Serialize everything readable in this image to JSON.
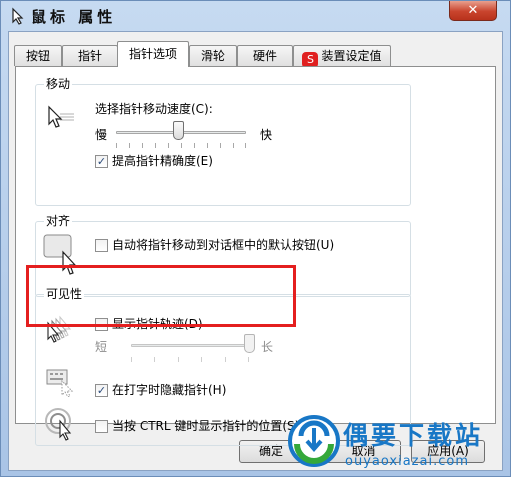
{
  "window": {
    "title": "鼠标 属性",
    "close_glyph": "✕"
  },
  "tabs": [
    {
      "label": "按钮"
    },
    {
      "label": "指针"
    },
    {
      "label": "指针选项",
      "active": true
    },
    {
      "label": "滑轮"
    },
    {
      "label": "硬件"
    },
    {
      "label": "装置设定值",
      "icon": "synaptics-icon"
    }
  ],
  "motion": {
    "title": "移动",
    "speed_label": "选择指针移动速度(C):",
    "slow": "慢",
    "fast": "快",
    "speed_level": 0.48,
    "precision_label": "提高指针精确度(E)",
    "precision_checked": true
  },
  "snap": {
    "title": "对齐",
    "label": "自动将指针移动到对话框中的默认按钮(U)",
    "checked": false
  },
  "visibility": {
    "title": "可见性",
    "trails_label": "显示指针轨迹(D)",
    "trails_checked": false,
    "short": "短",
    "long": "长",
    "trail_level": 1.0,
    "hide_label": "在打字时隐藏指针(H)",
    "hide_checked": true,
    "ctrl_label": "当按 CTRL 键时显示指针的位置(S)",
    "ctrl_checked": false
  },
  "buttons": {
    "ok": "确定",
    "cancel": "取消",
    "apply": "应用(A)"
  },
  "watermark": {
    "title": "偶要下载站",
    "url": "ouyaoxiazai.com"
  },
  "colors": {
    "highlight_box": "#e41f1f",
    "watermark": "#1877c6"
  }
}
